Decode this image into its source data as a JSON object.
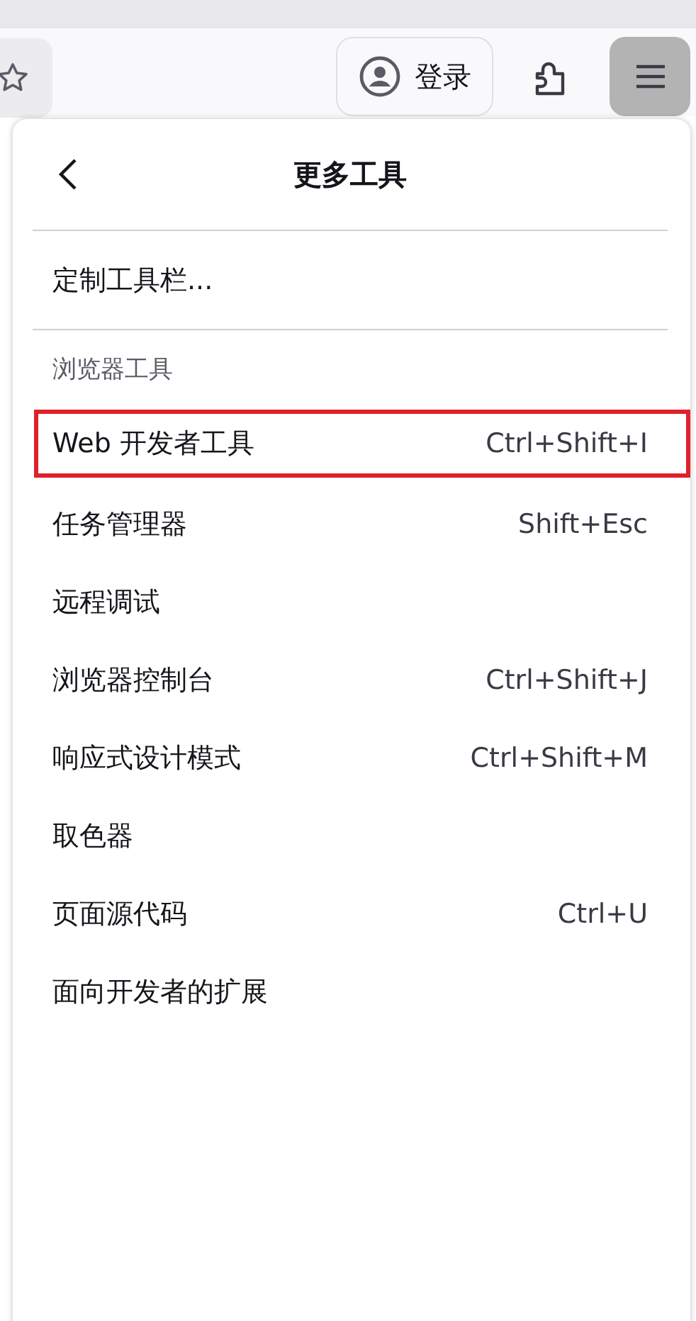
{
  "toolbar": {
    "sign_in": "登录"
  },
  "menu": {
    "title": "更多工具",
    "customize": "定制工具栏...",
    "section": "浏览器工具",
    "items": [
      {
        "label": "Web 开发者工具",
        "shortcut": "Ctrl+Shift+I",
        "highlighted": true
      },
      {
        "label": "任务管理器",
        "shortcut": "Shift+Esc",
        "highlighted": false
      },
      {
        "label": "远程调试",
        "highlighted": false
      },
      {
        "label": "浏览器控制台",
        "shortcut": "Ctrl+Shift+J",
        "highlighted": false
      },
      {
        "label": "响应式设计模式",
        "shortcut": "Ctrl+Shift+M",
        "highlighted": false
      },
      {
        "label": "取色器",
        "highlighted": false
      },
      {
        "label": "页面源代码",
        "shortcut": "Ctrl+U",
        "highlighted": false
      },
      {
        "label": "面向开发者的扩展",
        "highlighted": false
      }
    ]
  }
}
